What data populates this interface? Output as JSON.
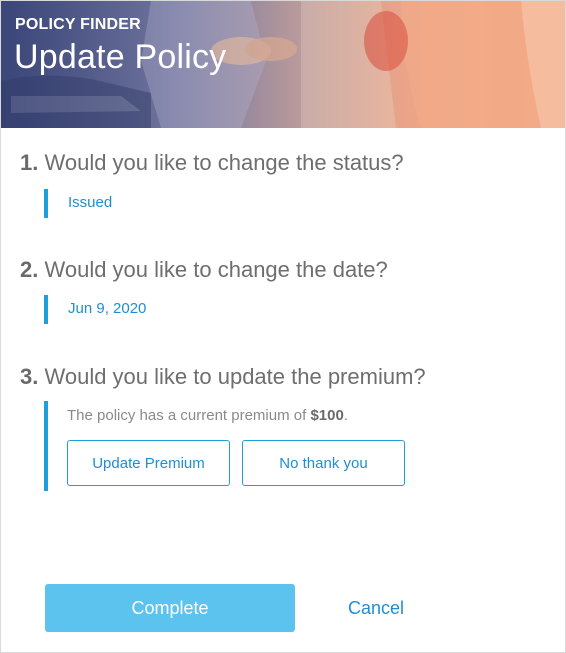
{
  "header": {
    "eyebrow": "POLICY FINDER",
    "title": "Update Policy"
  },
  "questions": [
    {
      "number": "1.",
      "text": "Would you like to change the status?",
      "answer": "Issued"
    },
    {
      "number": "2.",
      "text": "Would you like to change the date?",
      "answer": "Jun 9, 2020"
    },
    {
      "number": "3.",
      "text": "Would you like to update the premium?"
    }
  ],
  "premium": {
    "prefix": "The policy has a current premium of ",
    "amount": "$100",
    "suffix": ".",
    "update_button": "Update Premium",
    "decline_button": "No thank you"
  },
  "footer": {
    "complete_button": "Complete",
    "cancel_link": "Cancel"
  },
  "colors": {
    "accent": "#1e9fdc",
    "complete_button": "#5bc3ee",
    "question_text": "#6e6e6e"
  }
}
